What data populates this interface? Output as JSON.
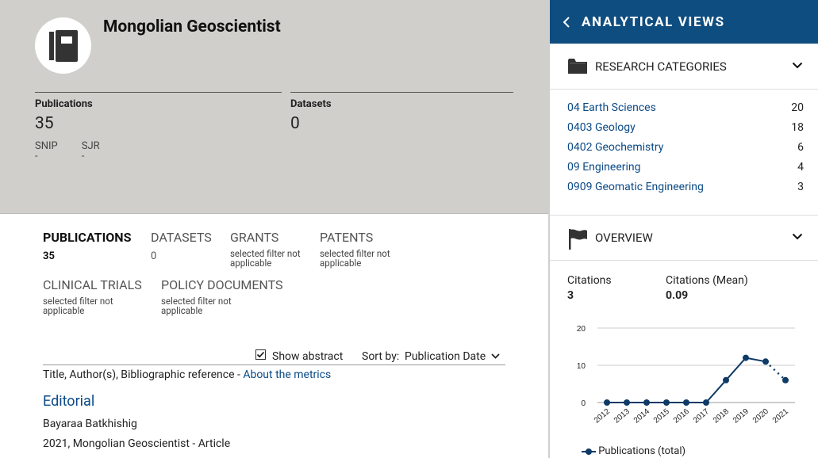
{
  "hero": {
    "title": "Mongolian Geoscientist",
    "publications": {
      "label": "Publications",
      "value": "35"
    },
    "datasets": {
      "label": "Datasets",
      "value": "0"
    },
    "snip": {
      "label": "SNIP",
      "value": "-"
    },
    "sjr": {
      "label": "SJR",
      "value": "-"
    }
  },
  "tabs": [
    {
      "label": "PUBLICATIONS",
      "count": "35"
    },
    {
      "label": "DATASETS",
      "count": "0"
    },
    {
      "label": "GRANTS",
      "note": "selected filter not applicable"
    },
    {
      "label": "PATENTS",
      "note": "selected filter not applicable"
    },
    {
      "label": "CLINICAL TRIALS",
      "note": "selected filter not applicable"
    },
    {
      "label": "POLICY DOCUMENTS",
      "note": "selected filter not applicable"
    }
  ],
  "controls": {
    "show_abstract": "Show abstract",
    "sort_by": "Sort by:",
    "sort_value": "Publication Date"
  },
  "list_header": {
    "text": "Title, Author(s), Bibliographic reference - ",
    "link": "About the metrics"
  },
  "article": {
    "title": "Editorial",
    "authors": "Bayaraa Batkhishig",
    "ref": "2021, Mongolian Geoscientist - Article"
  },
  "panel": {
    "title": "ANALYTICAL VIEWS",
    "research": {
      "label": "RESEARCH CATEGORIES",
      "items": [
        {
          "name": "04 Earth Sciences",
          "count": "20"
        },
        {
          "name": "0403 Geology",
          "count": "18"
        },
        {
          "name": "0402 Geochemistry",
          "count": "6"
        },
        {
          "name": "09 Engineering",
          "count": "4"
        },
        {
          "name": "0909 Geomatic Engineering",
          "count": "3"
        }
      ]
    },
    "overview": {
      "label": "OVERVIEW",
      "citations": {
        "label": "Citations",
        "value": "3"
      },
      "citations_mean": {
        "label": "Citations (Mean)",
        "value": "0.09"
      }
    }
  },
  "colors": {
    "accent": "#0e4d80",
    "link": "#0b4a86",
    "hero_bg": "#d0cfcc"
  },
  "chart_data": {
    "type": "line",
    "x": [
      "2012",
      "2013",
      "2014",
      "2015",
      "2016",
      "2017",
      "2018",
      "2019",
      "2020",
      "2021"
    ],
    "series": [
      {
        "name": "Publications (total)",
        "values": [
          0,
          0,
          0,
          0,
          0,
          0,
          6,
          12,
          11,
          6
        ]
      }
    ],
    "yticks": [
      "0",
      "10",
      "20"
    ],
    "ylim": [
      0,
      20
    ],
    "grid": true,
    "legend": "bottom-left",
    "note": "last segment (2020-2021) dotted"
  }
}
